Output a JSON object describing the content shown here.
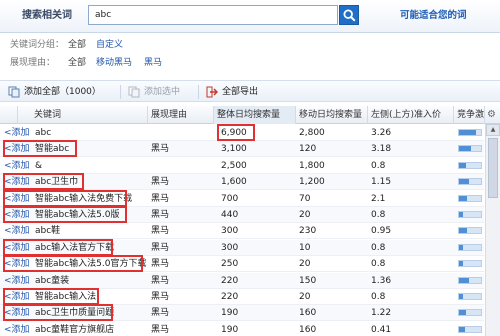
{
  "topbar": {
    "title": "搜索相关词",
    "search_value": "abc",
    "suggest_link": "可能适合您的词"
  },
  "filters": {
    "category": {
      "label": "关键词分组：",
      "options": [
        "全部",
        "自定义"
      ]
    },
    "reason": {
      "label": "展现理由：",
      "options": [
        "全部",
        "移动黑马",
        "黑马"
      ]
    }
  },
  "toolbar": {
    "add_all": "添加全部（1000）",
    "add_selected": "添加选中",
    "export_all": "全部导出"
  },
  "table": {
    "columns": [
      "关键词",
      "展现理由",
      "整体日均搜索量",
      "移动日均搜索量",
      "左侧(上方)准入价",
      "竞争激烈"
    ],
    "add_label": "<添加",
    "rows": [
      {
        "keyword": "abc",
        "reason": "",
        "total": "6,900",
        "mobile": "2,800",
        "price": "3.26",
        "competition": 0.75
      },
      {
        "keyword": "智能abc",
        "reason": "黑马",
        "total": "3,100",
        "mobile": "120",
        "price": "3.18",
        "competition": 0.55
      },
      {
        "keyword": "&",
        "reason": "",
        "total": "2,500",
        "mobile": "1,800",
        "price": "0.8",
        "competition": 0.3
      },
      {
        "keyword": "abc卫生巾",
        "reason": "黑马",
        "total": "1,600",
        "mobile": "1,200",
        "price": "1.15",
        "competition": 0.45
      },
      {
        "keyword": "智能abc输入法免费下载",
        "reason": "黑马",
        "total": "700",
        "mobile": "70",
        "price": "2.1",
        "competition": 0.35
      },
      {
        "keyword": "智能abc输入法5.0版",
        "reason": "黑马",
        "total": "440",
        "mobile": "20",
        "price": "0.8",
        "competition": 0.2
      },
      {
        "keyword": "abc鞋",
        "reason": "黑马",
        "total": "300",
        "mobile": "230",
        "price": "0.95",
        "competition": 0.35
      },
      {
        "keyword": "abc输入法官方下载",
        "reason": "黑马",
        "total": "300",
        "mobile": "10",
        "price": "0.8",
        "competition": 0.2
      },
      {
        "keyword": "智能abc输入法5.0官方下载",
        "reason": "黑马",
        "total": "250",
        "mobile": "20",
        "price": "0.8",
        "competition": 0.2
      },
      {
        "keyword": "abc童装",
        "reason": "黑马",
        "total": "220",
        "mobile": "150",
        "price": "1.36",
        "competition": 0.45
      },
      {
        "keyword": "智能abc输入法",
        "reason": "黑马",
        "total": "220",
        "mobile": "20",
        "price": "0.8",
        "competition": 0.2
      },
      {
        "keyword": "abc卫生巾质量问题",
        "reason": "黑马",
        "total": "190",
        "mobile": "160",
        "price": "1.22",
        "competition": 0.3
      },
      {
        "keyword": "abc童鞋官方旗舰店",
        "reason": "黑马",
        "total": "190",
        "mobile": "160",
        "price": "0.41",
        "competition": 0.25
      }
    ]
  },
  "colors": {
    "accent": "#1f6fc8",
    "highlight": "#e03030",
    "link": "#2255aa"
  }
}
